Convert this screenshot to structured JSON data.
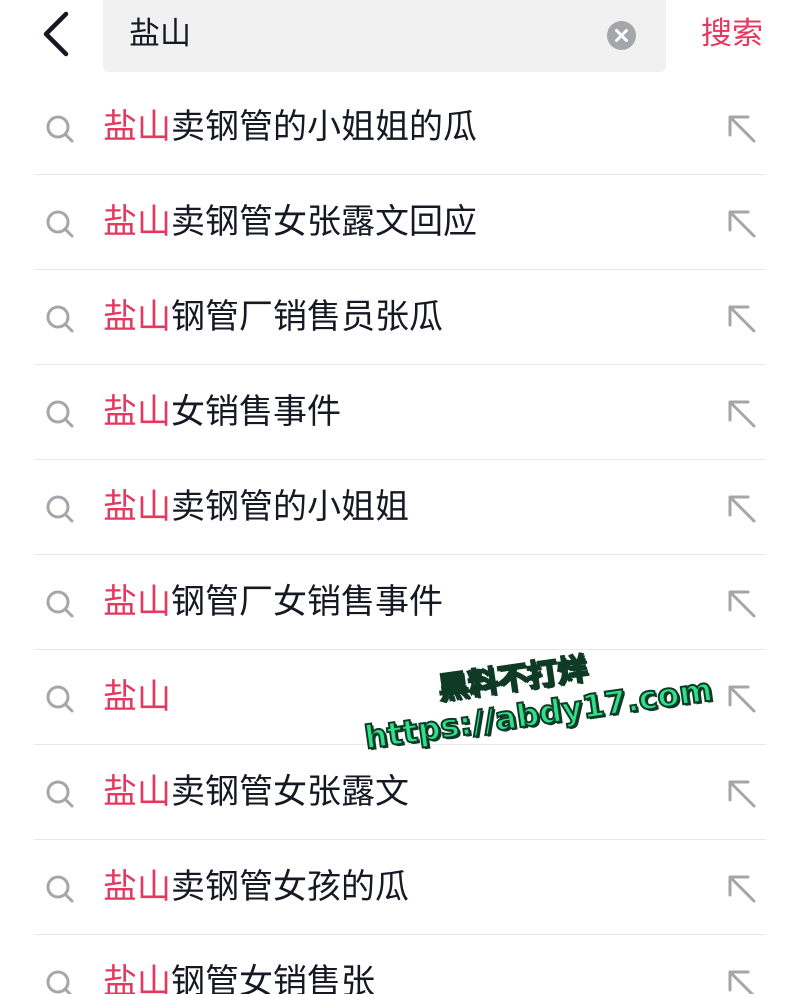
{
  "header": {
    "back_icon": "chevron-left-icon",
    "search_value": "盐山",
    "clear_icon": "clear-circle-icon",
    "search_button_label": "搜索"
  },
  "colors": {
    "accent": "#e4385f",
    "text": "#161823",
    "icon_gray": "#a5a6ab",
    "search_bg": "#f1f1f2",
    "watermark_green": "#2ee08a"
  },
  "suggestions": [
    {
      "highlight": "盐山",
      "rest": "卖钢管的小姐姐的瓜"
    },
    {
      "highlight": "盐山",
      "rest": "卖钢管女张露文回应"
    },
    {
      "highlight": "盐山",
      "rest": "钢管厂销售员张瓜"
    },
    {
      "highlight": "盐山",
      "rest": "女销售事件"
    },
    {
      "highlight": "盐山",
      "rest": "卖钢管的小姐姐"
    },
    {
      "highlight": "盐山",
      "rest": "钢管厂女销售事件"
    },
    {
      "highlight": "盐山",
      "rest": ""
    },
    {
      "highlight": "盐山",
      "rest": "卖钢管女张露文"
    },
    {
      "highlight": "盐山",
      "rest": "卖钢管女孩的瓜"
    },
    {
      "highlight": "盐山",
      "rest": "钢管女销售张"
    }
  ],
  "row_icons": {
    "left": "search-icon",
    "right": "arrow-up-left-icon"
  },
  "watermark": {
    "line1": "黑料不打烊",
    "line2": "https://abdy17.com"
  }
}
